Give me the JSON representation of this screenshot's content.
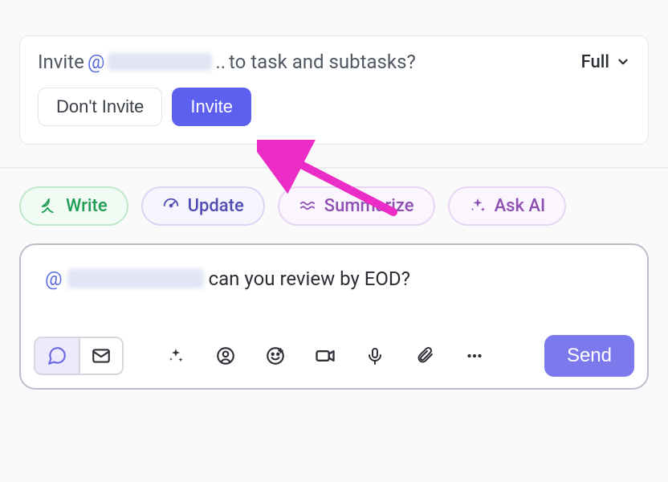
{
  "invite_prompt": {
    "prefix": "Invite",
    "at": "@",
    "mention_redacted": true,
    "ellipsis": "..",
    "suffix": "to task and subtasks?",
    "scope_label": "Full",
    "dont_invite_label": "Don't Invite",
    "invite_label": "Invite"
  },
  "pills": {
    "write": "Write",
    "update": "Update",
    "summarize": "Summarize",
    "askai": "Ask AI"
  },
  "composer": {
    "at": "@",
    "mention_redacted": true,
    "message_text": "can you review by EOD?",
    "send_label": "Send"
  },
  "colors": {
    "primary": "#5d5fef",
    "arrow": "#ec2cc6"
  }
}
